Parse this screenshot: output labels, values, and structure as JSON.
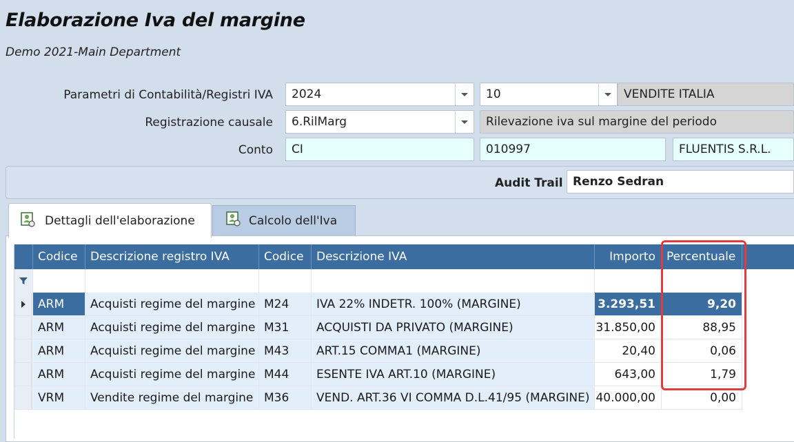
{
  "header": {
    "title": "Elaborazione Iva del margine",
    "subtitle": "Demo 2021-Main Department"
  },
  "params": {
    "parametri_label": "Parametri di Contabilità/Registri IVA",
    "year": "2024",
    "register_code": "10",
    "register_desc": "VENDITE ITALIA",
    "registrazione_label": "Registrazione causale",
    "causale_code": "6.RilMarg",
    "causale_desc": "Rilevazione iva sul margine del periodo",
    "conto_label": "Conto",
    "conto_type": "CI",
    "conto_code": "010997",
    "conto_name": "FLUENTIS S.R.L."
  },
  "audit": {
    "label": "Audit Trail",
    "value": "Renzo Sedran"
  },
  "tabs": [
    {
      "label": "Dettagli dell'elaborazione",
      "active": true,
      "icon": "user-report-icon"
    },
    {
      "label": "Calcolo dell'Iva",
      "active": false,
      "icon": "user-report-icon"
    }
  ],
  "grid": {
    "columns": [
      "Codice",
      "Descrizione registro IVA",
      "Codice",
      "Descrizione IVA",
      "Importo",
      "Percentuale"
    ],
    "rows": [
      {
        "codice": "ARM",
        "desc_registro": "Acquisti regime del margine",
        "codice_iva": "M24",
        "desc_iva": "IVA 22% INDETR. 100% (MARGINE)",
        "importo": "3.293,51",
        "percentuale": "9,20",
        "selected": true
      },
      {
        "codice": "ARM",
        "desc_registro": "Acquisti regime del margine",
        "codice_iva": "M31",
        "desc_iva": "ACQUISTI DA PRIVATO (MARGINE)",
        "importo": "31.850,00",
        "percentuale": "88,95",
        "selected": false
      },
      {
        "codice": "ARM",
        "desc_registro": "Acquisti regime del margine",
        "codice_iva": "M43",
        "desc_iva": "ART.15 COMMA1 (MARGINE)",
        "importo": "20,40",
        "percentuale": "0,06",
        "selected": false
      },
      {
        "codice": "ARM",
        "desc_registro": "Acquisti regime del margine",
        "codice_iva": "M44",
        "desc_iva": "ESENTE IVA ART.10 (MARGINE)",
        "importo": "643,00",
        "percentuale": "1,79",
        "selected": false
      },
      {
        "codice": "VRM",
        "desc_registro": "Vendite regime del margine",
        "codice_iva": "M36",
        "desc_iva": "VEND. ART.36 VI COMMA D.L.41/95 (MARGINE)",
        "importo": "40.000,00",
        "percentuale": "0,00",
        "selected": false
      }
    ]
  },
  "colors": {
    "header_bg": "#3b6da0",
    "highlight": "#e23b3b",
    "cyan_field": "#e6ffff",
    "app_bg": "#d3deed"
  }
}
